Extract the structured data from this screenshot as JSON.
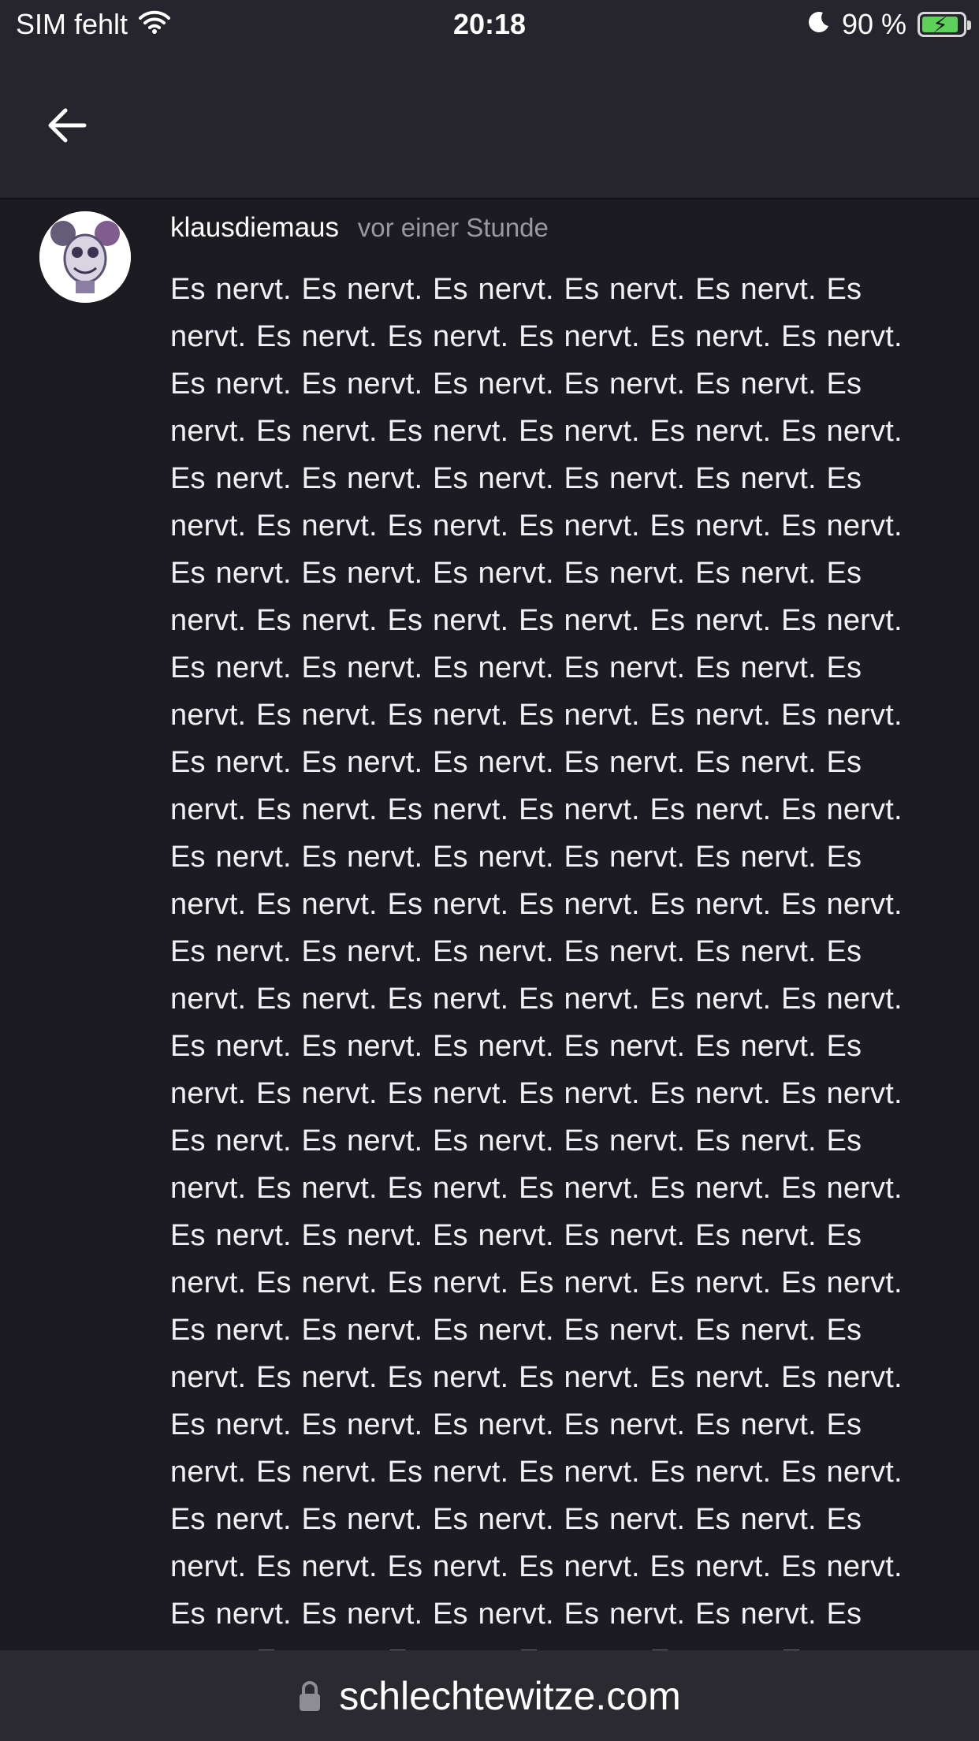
{
  "status_bar": {
    "carrier": "SIM fehlt",
    "time": "20:18",
    "battery": "90 %",
    "icons": [
      "wifi-icon",
      "moon-icon",
      "battery-charging-icon"
    ]
  },
  "header": {
    "back_icon": "arrow-left-icon"
  },
  "comment": {
    "username": "klausdiemaus",
    "timestamp": "vor einer Stunde",
    "text": "Es nervt. Es nervt. Es nervt. Es nervt. Es nervt. Es nervt. Es nervt. Es nervt. Es nervt. Es nervt. Es nervt. Es nervt. Es nervt. Es nervt. Es nervt. Es nervt. Es nervt. Es nervt. Es nervt. Es nervt. Es nervt. Es nervt. Es nervt. Es nervt. Es nervt. Es nervt. Es nervt. Es nervt. Es nervt. Es nervt. Es nervt. Es nervt. Es nervt. Es nervt. Es nervt. Es nervt. Es nervt. Es nervt. Es nervt. Es nervt. Es nervt. Es nervt. Es nervt. Es nervt. Es nervt. Es nervt. Es nervt. Es nervt. Es nervt. Es nervt. Es nervt. Es nervt. Es nervt. Es nervt. Es nervt. Es nervt. Es nervt. Es nervt. Es nervt. Es nervt. Es nervt. Es nervt. Es nervt. Es nervt. Es nervt. Es nervt. Es nervt. Es nervt. Es nervt. Es nervt. Es nervt. Es nervt. Es nervt. Es nervt. Es nervt. Es nervt. Es nervt. Es nervt. Es nervt. Es nervt. Es nervt. Es nervt. Es nervt. Es nervt. Es nervt. Es nervt. Es nervt. Es nervt. Es nervt. Es nervt. Es nervt. Es nervt. Es nervt. Es nervt. Es nervt. Es nervt. Es nervt. Es nervt. Es nervt. Es nervt. Es nervt. Es nervt. Es nervt. Es nervt. Es nervt. Es nervt. Es nervt. Es nervt. Es nervt. Es nervt. Es nervt. Es nervt. Es nervt. Es nervt. Es nervt. Es nervt. Es nervt. Es nervt. Es nervt. Es nervt. Es nervt. Es nervt. Es nervt. Es nervt. Es nervt. Es nervt. Es nervt. Es nervt. Es nervt. Es nervt. Es nervt. Es nervt. Es nervt. Es nervt. Es nervt. Es nervt. Es nervt. Es nervt. Es nervt. Es nervt. Es nervt. Es nervt. Es nervt. Es nervt. Es nervt. Es nervt. Es nervt. Es nervt. Es nervt. Es nervt. Es nervt. Es nervt. Es nervt. Es nervt. Es nervt. Es nervt. Es nervt. Es nervt. Es nervt. Es nervt. Es nervt. Es nervt. Es nervt. Es nervt. Es nervt. Es nervt. Es nervt. Es nervt. Es nervt. Es nervt. Es nervt. Es nervt."
  },
  "url_bar": {
    "url": "schlechtewitze.com",
    "icon": "lock-icon"
  },
  "colors": {
    "background": "#1c1b21",
    "bar": "#26242c",
    "battery_green": "#5ed15a"
  }
}
